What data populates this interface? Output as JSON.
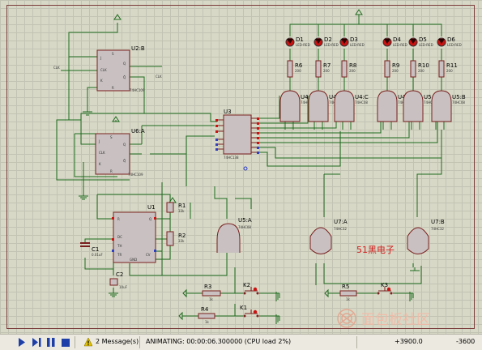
{
  "schematic": {
    "components": {
      "u2b": {
        "ref": "U2:B",
        "part": "74HC109",
        "pins": [
          "J",
          "CLK",
          "K",
          "Q",
          "Q̄",
          "S",
          "R"
        ]
      },
      "u6a": {
        "ref": "U6:A",
        "part": "74HC109",
        "pins": [
          "J",
          "CLK",
          "K",
          "Q",
          "Q̄",
          "S",
          "R"
        ]
      },
      "u3": {
        "ref": "U3",
        "part": "74HC138"
      },
      "u1": {
        "ref": "U1",
        "part": "555",
        "pins": [
          "R",
          "DC",
          "Q",
          "TH",
          "TR",
          "CV",
          "GND"
        ]
      },
      "r1": {
        "ref": "R1",
        "value": "33k"
      },
      "r2": {
        "ref": "R2",
        "value": "33k"
      },
      "c1": {
        "ref": "C1",
        "value": "0.01uF"
      },
      "c2": {
        "ref": "C2",
        "value": "10uF"
      },
      "u5a": {
        "ref": "U5:A",
        "part": "74HC08"
      },
      "u7a": {
        "ref": "U7:A",
        "part": "74HC32"
      },
      "u7b": {
        "ref": "U7:B",
        "part": "74HC32"
      },
      "r3": {
        "ref": "R3",
        "value": "1k"
      },
      "r4": {
        "ref": "R4",
        "value": "1k"
      },
      "r5": {
        "ref": "R5",
        "value": "1k"
      },
      "k1": {
        "ref": "K1"
      },
      "k2": {
        "ref": "K2"
      },
      "k3": {
        "ref": "K3"
      },
      "leds": [
        {
          "ref": "D1",
          "part": "LED-RED"
        },
        {
          "ref": "D2",
          "part": "LED-RED"
        },
        {
          "ref": "D3",
          "part": "LED-RED"
        },
        {
          "ref": "D4",
          "part": "LED-RED"
        },
        {
          "ref": "D5",
          "part": "LED-RED"
        },
        {
          "ref": "D6",
          "part": "LED-RED"
        }
      ],
      "led_resistors": [
        {
          "ref": "R6",
          "value": "200"
        },
        {
          "ref": "R7",
          "value": "200"
        },
        {
          "ref": "R8",
          "value": "200"
        },
        {
          "ref": "R9",
          "value": "200"
        },
        {
          "ref": "R10",
          "value": "200"
        },
        {
          "ref": "R11",
          "value": "200"
        }
      ],
      "and_gates": [
        {
          "ref": "U4:A",
          "part": "74HC08"
        },
        {
          "ref": "U4:B",
          "part": "74HC08"
        },
        {
          "ref": "U4:C",
          "part": "74HC08"
        },
        {
          "ref": "U4:D",
          "part": "74HC08"
        },
        {
          "ref": "U5:C",
          "part": "74HC08"
        },
        {
          "ref": "U5:B",
          "part": "74HC08"
        }
      ]
    },
    "net_labels": {
      "clk_in": "CLK",
      "clk_out": "CLK"
    },
    "red_note": "51黑电子"
  },
  "statusbar": {
    "play_icon": "play-icon",
    "step_icon": "step-icon",
    "pause_icon": "pause-icon",
    "stop_icon": "stop-icon",
    "messages": "2 Message(s)",
    "sim_status": "ANIMATING: 00:00:06.300000 (CPU load 2%)",
    "coord_x": "+3900.0",
    "coord_y": "-3600"
  },
  "watermark": {
    "text": "面包板社区"
  },
  "colors": {
    "wire": "#1f6b1f",
    "component": "#7a1f1f",
    "component_fill": "#c8c0c0",
    "led": "#cc1111",
    "grid_bg": "#d7d8c6",
    "sheet_border": "#7a3b3b",
    "red_note": "#d22020"
  }
}
